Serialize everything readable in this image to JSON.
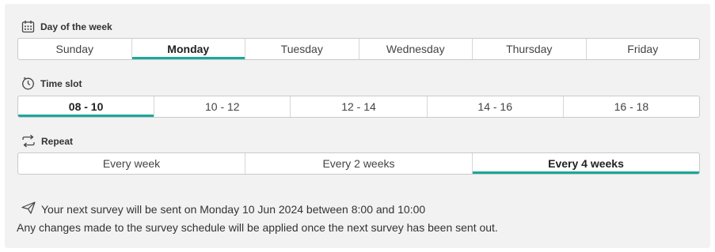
{
  "day_section": {
    "label": "Day of the week",
    "icon": "calendar-icon",
    "options": [
      "Sunday",
      "Monday",
      "Tuesday",
      "Wednesday",
      "Thursday",
      "Friday"
    ],
    "selected": "Monday"
  },
  "time_section": {
    "label": "Time slot",
    "icon": "clock-icon",
    "options": [
      "08 - 10",
      "10 - 12",
      "12 - 14",
      "14 - 16",
      "16 - 18"
    ],
    "selected": "08 - 10"
  },
  "repeat_section": {
    "label": "Repeat",
    "icon": "repeat-icon",
    "options": [
      "Every week",
      "Every 2 weeks",
      "Every 4 weeks"
    ],
    "selected": "Every 4 weeks"
  },
  "info": {
    "icon": "send-icon",
    "next_survey": "Your next survey will be sent on Monday 10 Jun 2024 between 8:00 and 10:00",
    "note": "Any changes made to the survey schedule will be applied once the next survey has been sent out."
  },
  "colors": {
    "accent": "#1aa89a",
    "panel_bg": "#f2f2f2",
    "border": "#c9c9c9"
  }
}
